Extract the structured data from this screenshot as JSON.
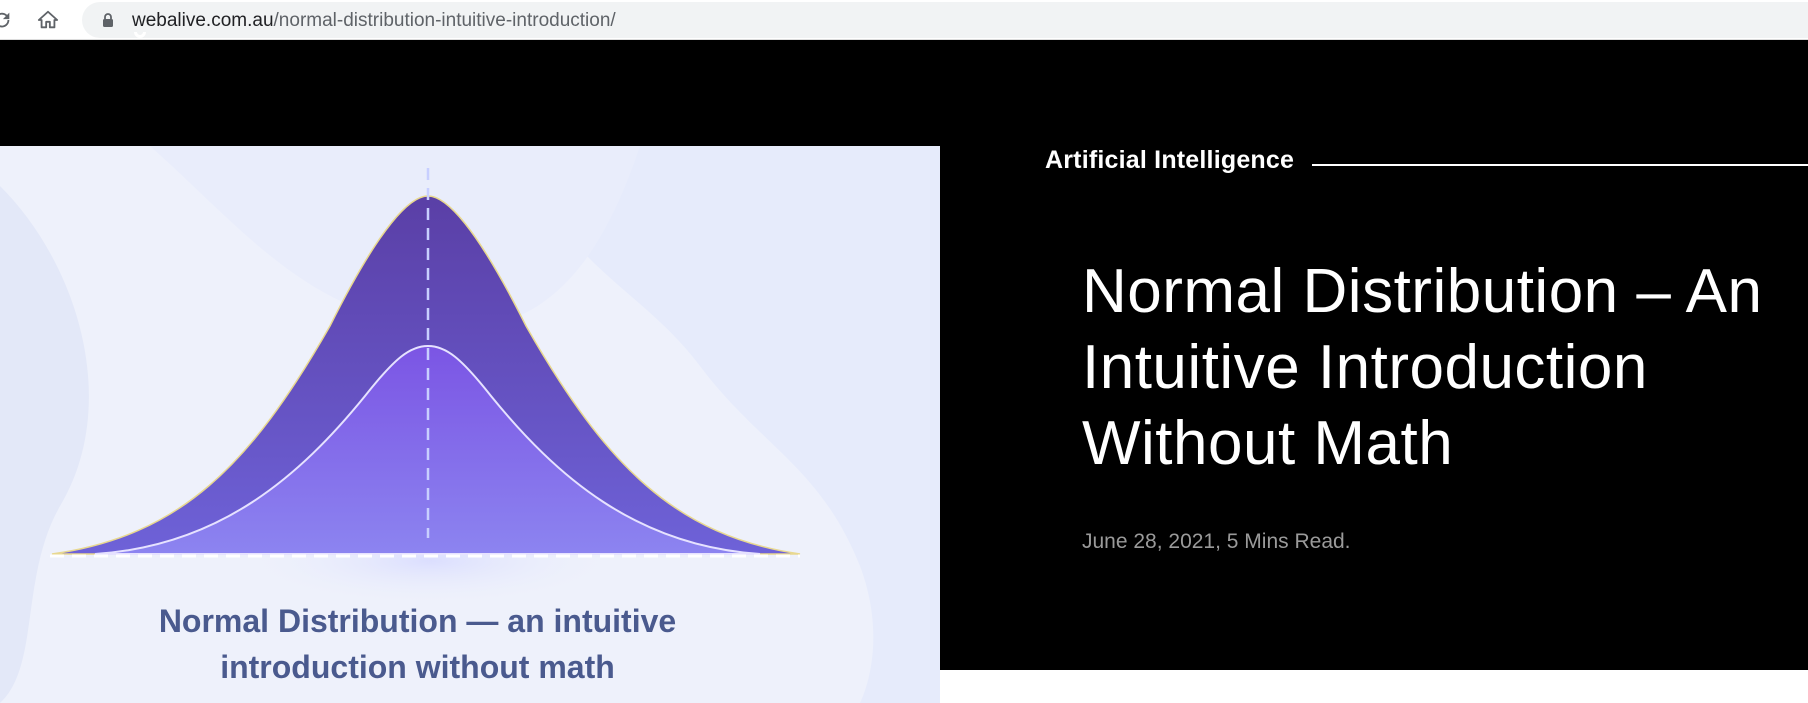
{
  "browser": {
    "url_host": "webalive.com.au",
    "url_path": "/normal-distribution-intuitive-introduction/",
    "icons": [
      "reload-icon",
      "home-icon",
      "lock-icon"
    ]
  },
  "hero": {
    "image_caption_line1": "Normal Distribution — an intuitive",
    "image_caption_line2": "introduction without math",
    "category": "Artificial Intelligence",
    "title_line1": "Normal Distribution – An",
    "title_line2": "Intuitive Introduction",
    "title_line3": "Without Math",
    "meta": "June 28, 2021, 5 Mins Read."
  },
  "colors": {
    "header_bg": "#000000",
    "image_bg": "#eef1fb",
    "curve_dark": "#5a44b0",
    "curve_light": "#8a74f0",
    "caption": "#4a5a8e",
    "meta": "#9a9a9a"
  }
}
